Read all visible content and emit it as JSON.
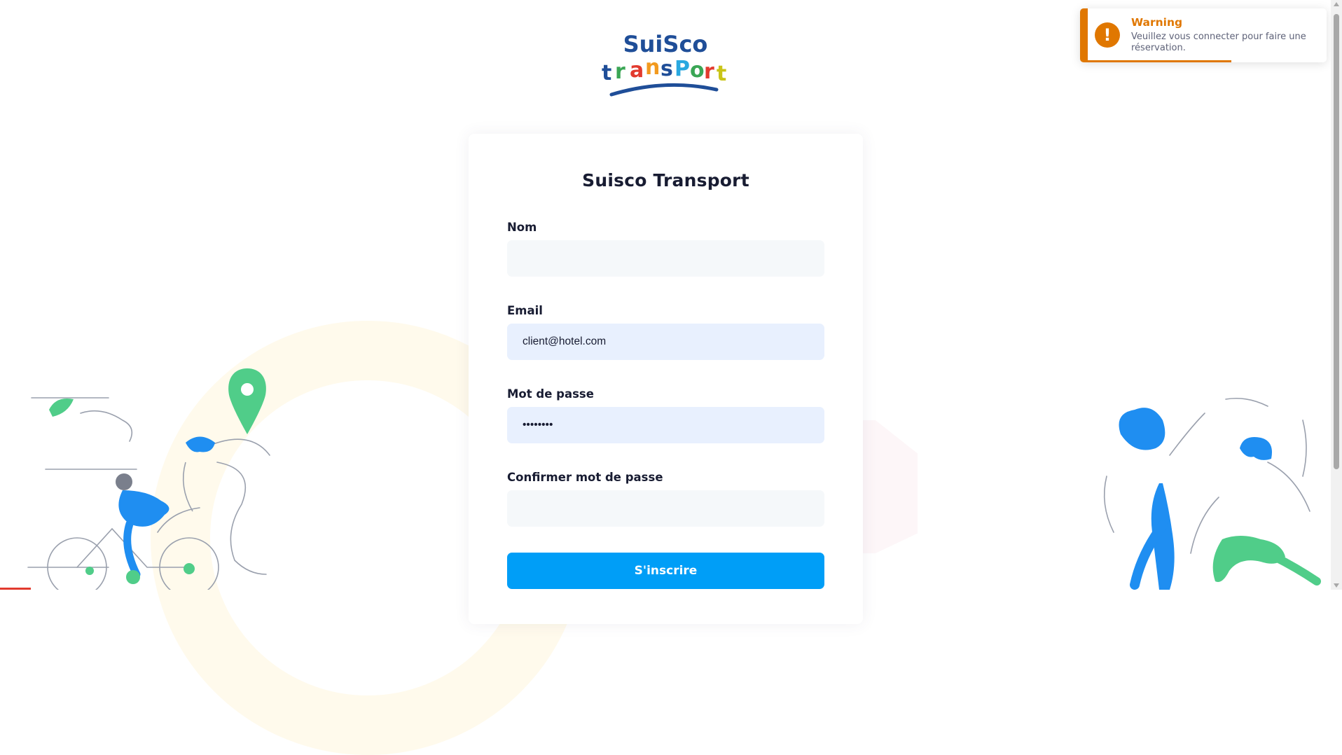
{
  "logo": {
    "line1": "SuiSco",
    "line2_letters": [
      "t",
      "r",
      "a",
      "n",
      "s",
      "P",
      "o",
      "r",
      "t"
    ]
  },
  "form": {
    "title": "Suisco Transport",
    "fields": [
      {
        "label": "Nom",
        "value": "",
        "placeholder": ""
      },
      {
        "label": "Email",
        "value": "client@hotel.com",
        "placeholder": ""
      },
      {
        "label": "Mot de passe",
        "value": "password",
        "placeholder": ""
      },
      {
        "label": "Confirmer mot de passe",
        "value": "",
        "placeholder": ""
      }
    ],
    "submit_label": "S'inscrire"
  },
  "toast": {
    "title": "Warning",
    "message": "Veuillez vous connecter pour faire une réservation.",
    "icon": "exclamation-icon",
    "progress": 0.6
  },
  "colors": {
    "primary": "#009ef7",
    "warning": "#e07700",
    "input_bg": "#f5f8fa",
    "input_autofill_bg": "#e8f0fe",
    "title_text": "#181c32",
    "illustration_blue": "#1f8ef1",
    "illustration_green": "#50cd89"
  }
}
